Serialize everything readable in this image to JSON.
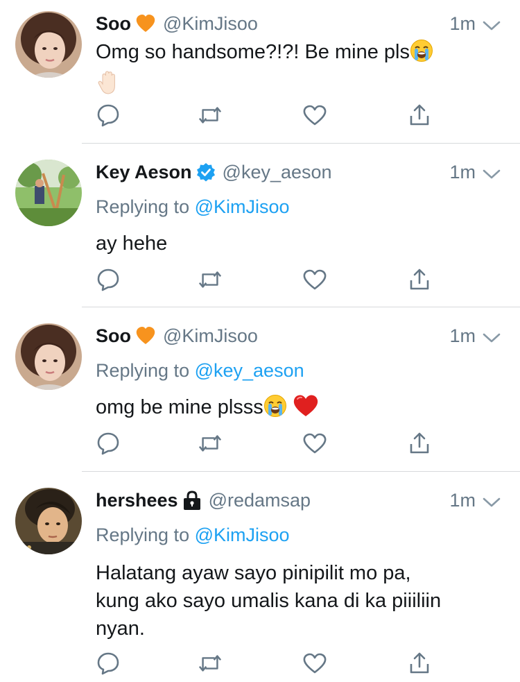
{
  "tweets": [
    {
      "name": "Soo",
      "name_badge_icon": "orange-heart-icon",
      "handle": "@KimJisoo",
      "time": "1m",
      "replying_prefix": "",
      "replying_to": "",
      "text_lines": [
        "Omg so handsome?!?! Be mine pls"
      ],
      "emojis": [
        "loudly-crying-face-icon",
        "raised-hand-icon"
      ]
    },
    {
      "name": "Key Aeson",
      "name_badge_icon": "verified-badge-icon",
      "handle": "@key_aeson",
      "time": "1m",
      "replying_prefix": "Replying to ",
      "replying_to": "@KimJisoo",
      "text_lines": [
        "ay hehe"
      ],
      "emojis": []
    },
    {
      "name": "Soo",
      "name_badge_icon": "orange-heart-icon",
      "handle": "@KimJisoo",
      "time": "1m",
      "replying_prefix": "Replying to ",
      "replying_to": "@key_aeson",
      "text_lines": [
        "omg be mine plsss"
      ],
      "emojis": [
        "loudly-crying-face-icon",
        "red-heart-icon"
      ]
    },
    {
      "name": "hershees",
      "name_badge_icon": "lock-icon",
      "handle": "@redamsap",
      "time": "1m",
      "replying_prefix": "Replying to ",
      "replying_to": "@KimJisoo",
      "text_lines": [
        "Halatang ayaw sayo pinipilit mo pa,",
        "kung ako sayo umalis kana di ka piiiliin",
        "nyan."
      ],
      "emojis": []
    }
  ],
  "action_icons": [
    "reply-icon",
    "retweet-icon",
    "like-icon",
    "share-icon"
  ],
  "colors": {
    "text": "#14171a",
    "secondary": "#657786",
    "link": "#1da1f2",
    "divider": "#d7d9dc",
    "orange_heart": "#f7931e",
    "red_heart": "#e0201f"
  }
}
